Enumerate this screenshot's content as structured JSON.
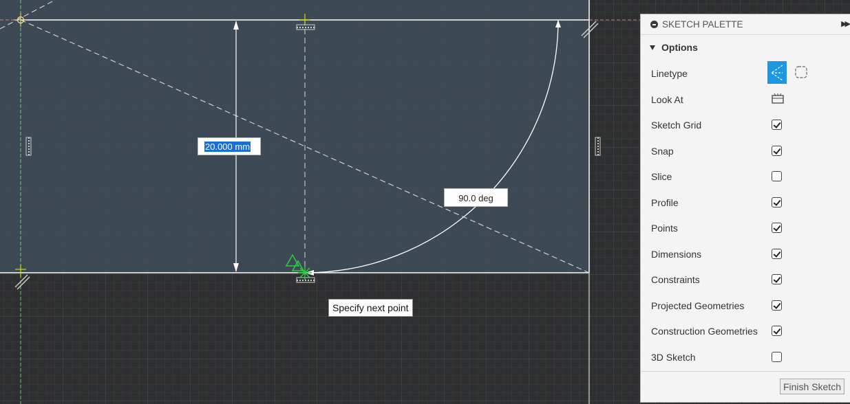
{
  "viewport": {
    "length_value": "20.000 mm",
    "angle_value": "90.0 deg",
    "tooltip": "Specify next point"
  },
  "palette": {
    "title": "SKETCH PALETTE",
    "section": "Options",
    "rows": [
      {
        "label": "Linetype",
        "kind": "linetype"
      },
      {
        "label": "Look At",
        "kind": "button"
      },
      {
        "label": "Sketch Grid",
        "kind": "checkbox",
        "checked": true
      },
      {
        "label": "Snap",
        "kind": "checkbox",
        "checked": true
      },
      {
        "label": "Slice",
        "kind": "checkbox",
        "checked": false
      },
      {
        "label": "Profile",
        "kind": "checkbox",
        "checked": true
      },
      {
        "label": "Points",
        "kind": "checkbox",
        "checked": true
      },
      {
        "label": "Dimensions",
        "kind": "checkbox",
        "checked": true
      },
      {
        "label": "Constraints",
        "kind": "checkbox",
        "checked": true
      },
      {
        "label": "Projected Geometries",
        "kind": "checkbox",
        "checked": true
      },
      {
        "label": "Construction Geometries",
        "kind": "checkbox",
        "checked": true
      },
      {
        "label": "3D Sketch",
        "kind": "checkbox",
        "checked": false
      }
    ],
    "finish_label": "Finish Sketch"
  },
  "colors": {
    "accent": "#1e97e3",
    "constraint_green": "#2ecc40"
  }
}
